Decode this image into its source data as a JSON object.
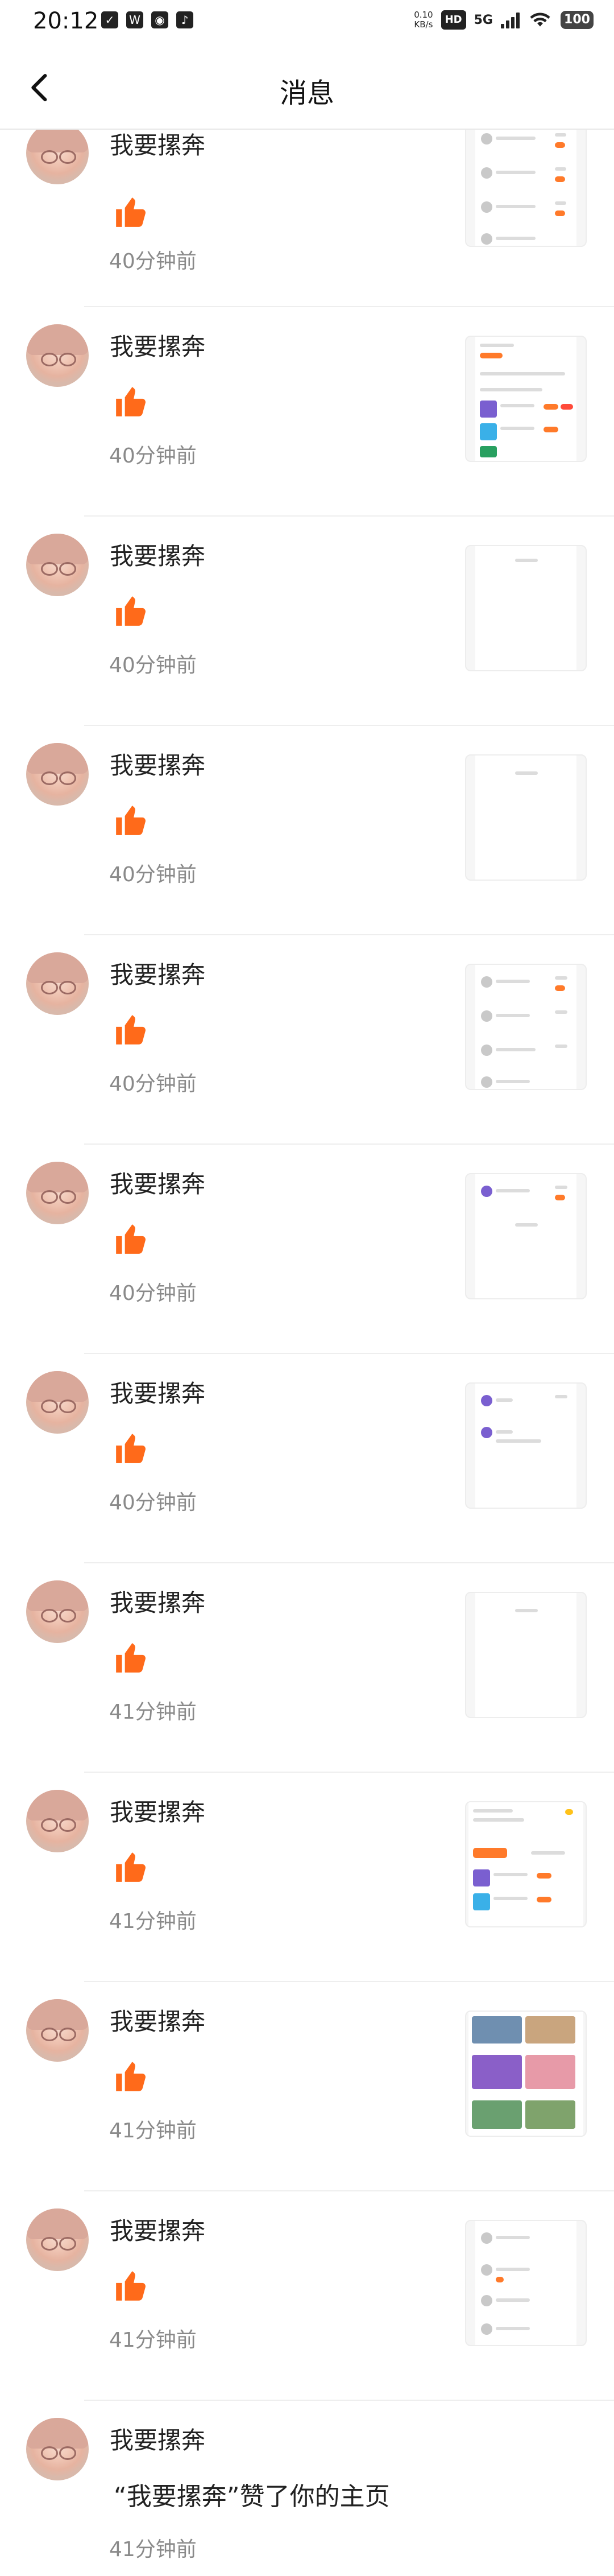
{
  "status_bar": {
    "time": "20:12",
    "network_speed_top": "0.10",
    "network_speed_bottom": "KB/s",
    "hd_badge": "HD",
    "signal_label": "5G",
    "battery": "100",
    "app_icons": [
      "check-icon",
      "w-icon",
      "wechat-icon",
      "tiktok-icon"
    ]
  },
  "header": {
    "title": "消息",
    "back_icon": "chevron-left-icon"
  },
  "colors": {
    "accent": "#ff6a1a",
    "secondary_text": "#8a8a8a"
  },
  "notifications": [
    {
      "user": "我要摞奔",
      "type": "like",
      "time": "40分钟前"
    },
    {
      "user": "我要摞奔",
      "type": "like",
      "time": "40分钟前"
    },
    {
      "user": "我要摞奔",
      "type": "like",
      "time": "40分钟前"
    },
    {
      "user": "我要摞奔",
      "type": "like",
      "time": "40分钟前"
    },
    {
      "user": "我要摞奔",
      "type": "like",
      "time": "40分钟前"
    },
    {
      "user": "我要摞奔",
      "type": "like",
      "time": "40分钟前"
    },
    {
      "user": "我要摞奔",
      "type": "like",
      "time": "40分钟前"
    },
    {
      "user": "我要摞奔",
      "type": "like",
      "time": "41分钟前"
    },
    {
      "user": "我要摞奔",
      "type": "like",
      "time": "41分钟前"
    },
    {
      "user": "我要摞奔",
      "type": "like",
      "time": "41分钟前"
    },
    {
      "user": "我要摞奔",
      "type": "like",
      "time": "41分钟前"
    },
    {
      "user": "我要摞奔",
      "type": "homepage_like",
      "message": "“我要摞奔”赞了你的主页",
      "time": "41分钟前"
    }
  ]
}
